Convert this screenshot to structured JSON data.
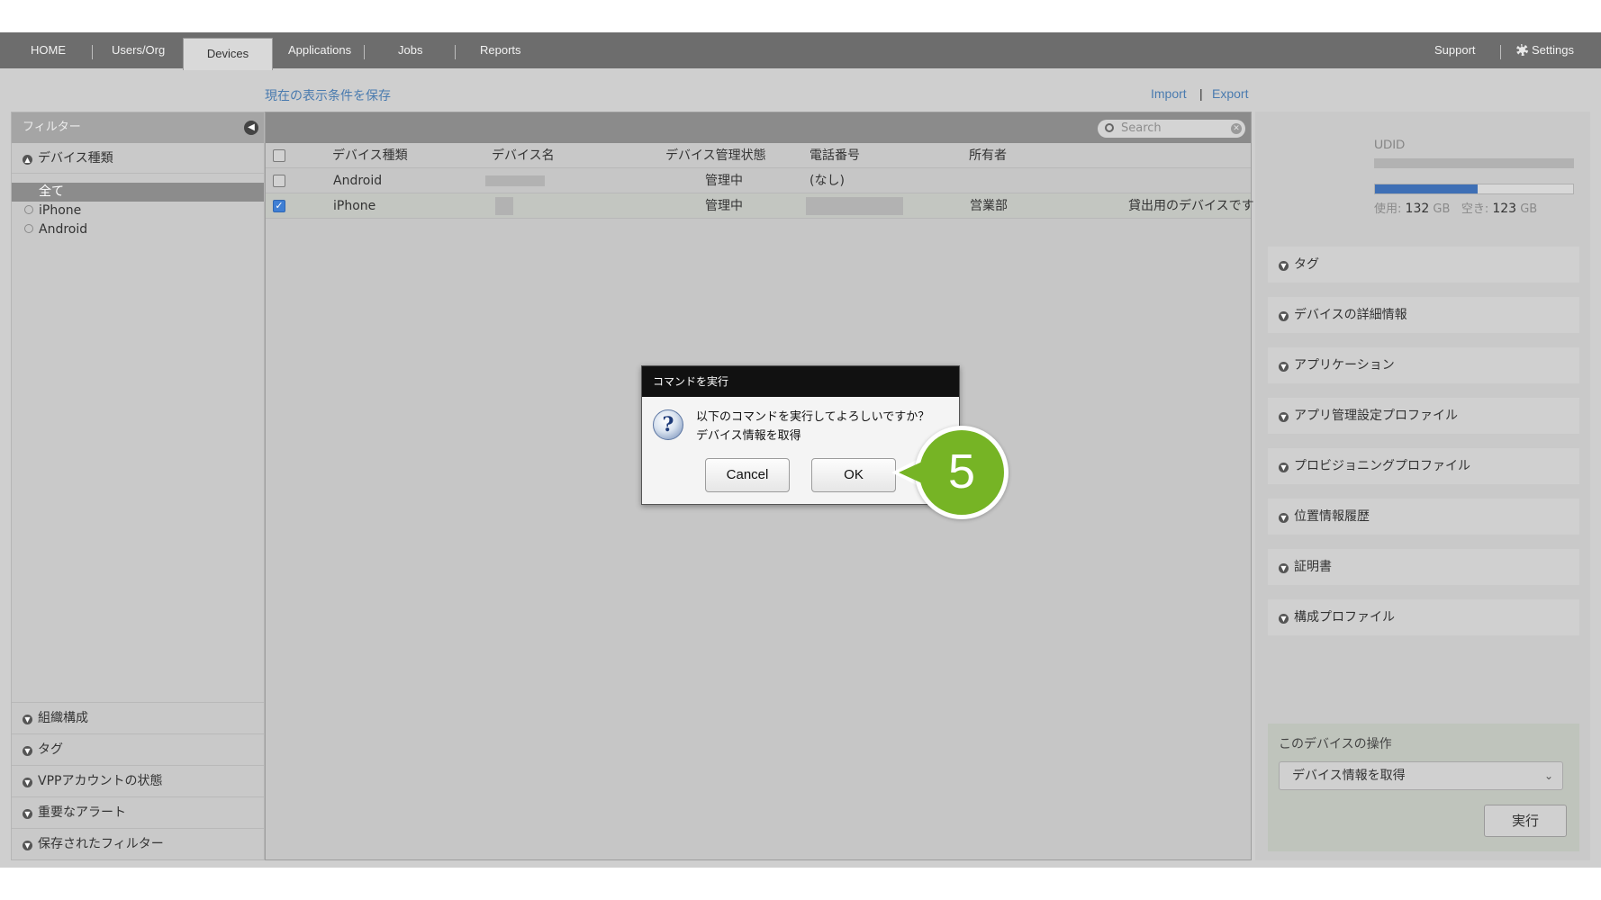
{
  "nav": {
    "home": "HOME",
    "users_org": "Users/Org",
    "devices": "Devices",
    "applications": "Applications",
    "jobs": "Jobs",
    "reports": "Reports",
    "support": "Support",
    "settings": "Settings"
  },
  "toplinks": {
    "save_view": "現在の表示条件を保存",
    "import": "Import",
    "separator": "|",
    "export": "Export"
  },
  "left": {
    "filter_title": "フィルター",
    "device_type_section": "デバイス種類",
    "filters": [
      "全て",
      "iPhone",
      "Android"
    ],
    "bottom_sections": [
      "組織構成",
      "タグ",
      "VPPアカウントの状態",
      "重要なアラート",
      "保存されたフィルター"
    ]
  },
  "table": {
    "search_placeholder": "Search",
    "headers": [
      "デバイス種類",
      "デバイス名",
      "デバイス管理状態",
      "電話番号",
      "所有者"
    ],
    "rows": [
      {
        "type": "Android",
        "status": "管理中",
        "phone": "(なし)",
        "owner": "",
        "note": "",
        "checked": false
      },
      {
        "type": "iPhone",
        "status": "管理中",
        "phone": "",
        "owner": "営業部",
        "note": "貸出用のデバイスです",
        "checked": true
      }
    ]
  },
  "right": {
    "udid_label": "UDID",
    "storage_used_label": "使用:",
    "storage_used_value": "132",
    "storage_unit": "GB",
    "storage_free_label": "空き:",
    "storage_free_value": "123",
    "storage_used_fraction": 0.52,
    "sections": [
      "タグ",
      "デバイスの詳細情報",
      "アプリケーション",
      "アプリ管理設定プロファイル",
      "プロビジョニングプロファイル",
      "位置情報履歴",
      "証明書",
      "構成プロファイル"
    ],
    "ops_title": "このデバイスの操作",
    "ops_selected": "デバイス情報を取得",
    "ops_run": "実行"
  },
  "dialog": {
    "title": "コマンドを実行",
    "message_line1": "以下のコマンドを実行してよろしいですか？",
    "message_line2": "デバイス情報を取得",
    "cancel": "Cancel",
    "ok": "OK"
  },
  "callout": {
    "number": "5",
    "color": "#76b425"
  },
  "colors": {
    "link": "#4a7baf",
    "storage_bar": "#3e6fb5",
    "nav_bg": "#6d6d6d"
  }
}
